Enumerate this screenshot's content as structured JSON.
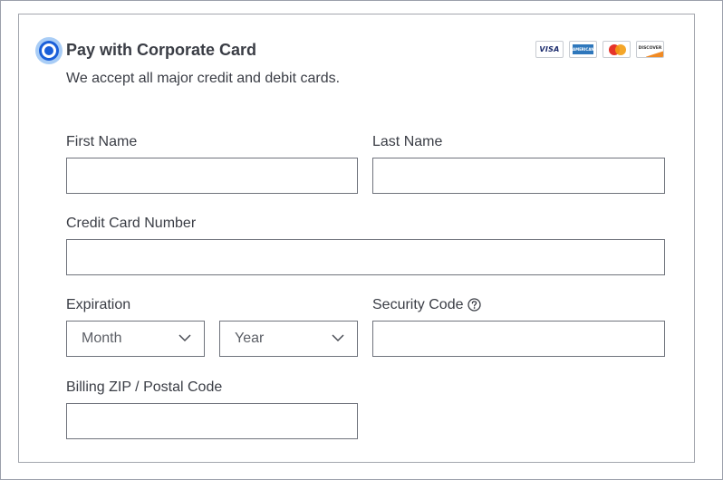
{
  "payment": {
    "title": "Pay with Corporate Card",
    "subtitle": "We accept all major credit and debit cards.",
    "selected": true
  },
  "card_logos": [
    {
      "name": "visa-icon",
      "text": "VISA"
    },
    {
      "name": "amex-icon",
      "text": "AMERICAN EXPRESS"
    },
    {
      "name": "mastercard-icon",
      "text": "mastercard"
    },
    {
      "name": "discover-icon",
      "text": "DISCOVER"
    }
  ],
  "form": {
    "first_name": {
      "label": "First Name",
      "value": ""
    },
    "last_name": {
      "label": "Last Name",
      "value": ""
    },
    "card_number": {
      "label": "Credit Card Number",
      "value": ""
    },
    "expiration": {
      "label": "Expiration",
      "month_placeholder": "Month",
      "year_placeholder": "Year"
    },
    "security_code": {
      "label": "Security Code",
      "value": "",
      "help_icon": "question-circle-icon"
    },
    "zip": {
      "label": "Billing ZIP / Postal Code",
      "value": ""
    }
  },
  "colors": {
    "accent": "#1a5fd9",
    "accent_glow": "#a9cdf6",
    "border": "#6f737c",
    "text": "#3a3d45"
  }
}
